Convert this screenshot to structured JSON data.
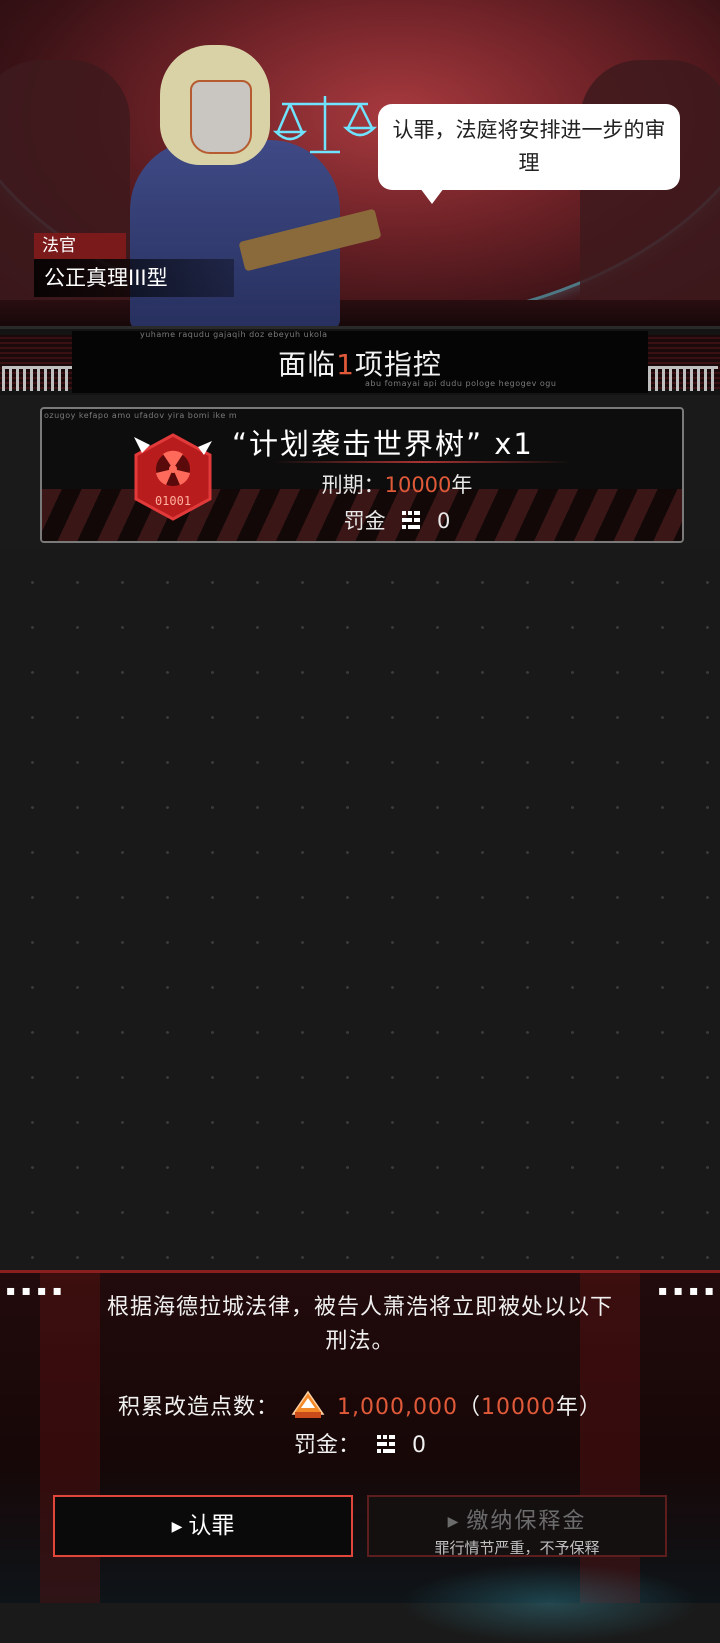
{
  "hero": {
    "speech": "认罪，法庭将安排进一步的审理",
    "judge_title": "法官",
    "judge_name": "公正真理III型"
  },
  "charges_header": {
    "prefix": "面临",
    "count": "1",
    "suffix": "项指控",
    "deco_top": "yuhame raqudu gajaqih doz ebeyuh ukola",
    "deco_bottom": "abu fomayai api dudu pologe hegogev ogu"
  },
  "charge": {
    "deco": "ozugoy kefapo amo ufadov yira bomi ike m",
    "name": "“计划袭击世界树” x1",
    "term_label": "刑期：",
    "term_value": "10000",
    "term_unit": "年",
    "fine_label": "罚金",
    "fine_value": "0",
    "icon": "radiation-hazard-icon"
  },
  "verdict": {
    "text": "根据海德拉城法律，被告人萧浩将立即被处以以下刑法。",
    "points_label": "积累改造点数：",
    "points_value": "1,000,000",
    "points_paren_open": "（",
    "points_years": "10000",
    "points_years_unit": "年）",
    "fine_label": "罚金：",
    "fine_value": "0"
  },
  "buttons": {
    "plead_label": "认罪",
    "bail_label": "缴纳保释金",
    "bail_sub": "罪行情节严重，不予保释"
  },
  "colors": {
    "accent": "#e05a3a",
    "border_red": "#e0463a"
  }
}
